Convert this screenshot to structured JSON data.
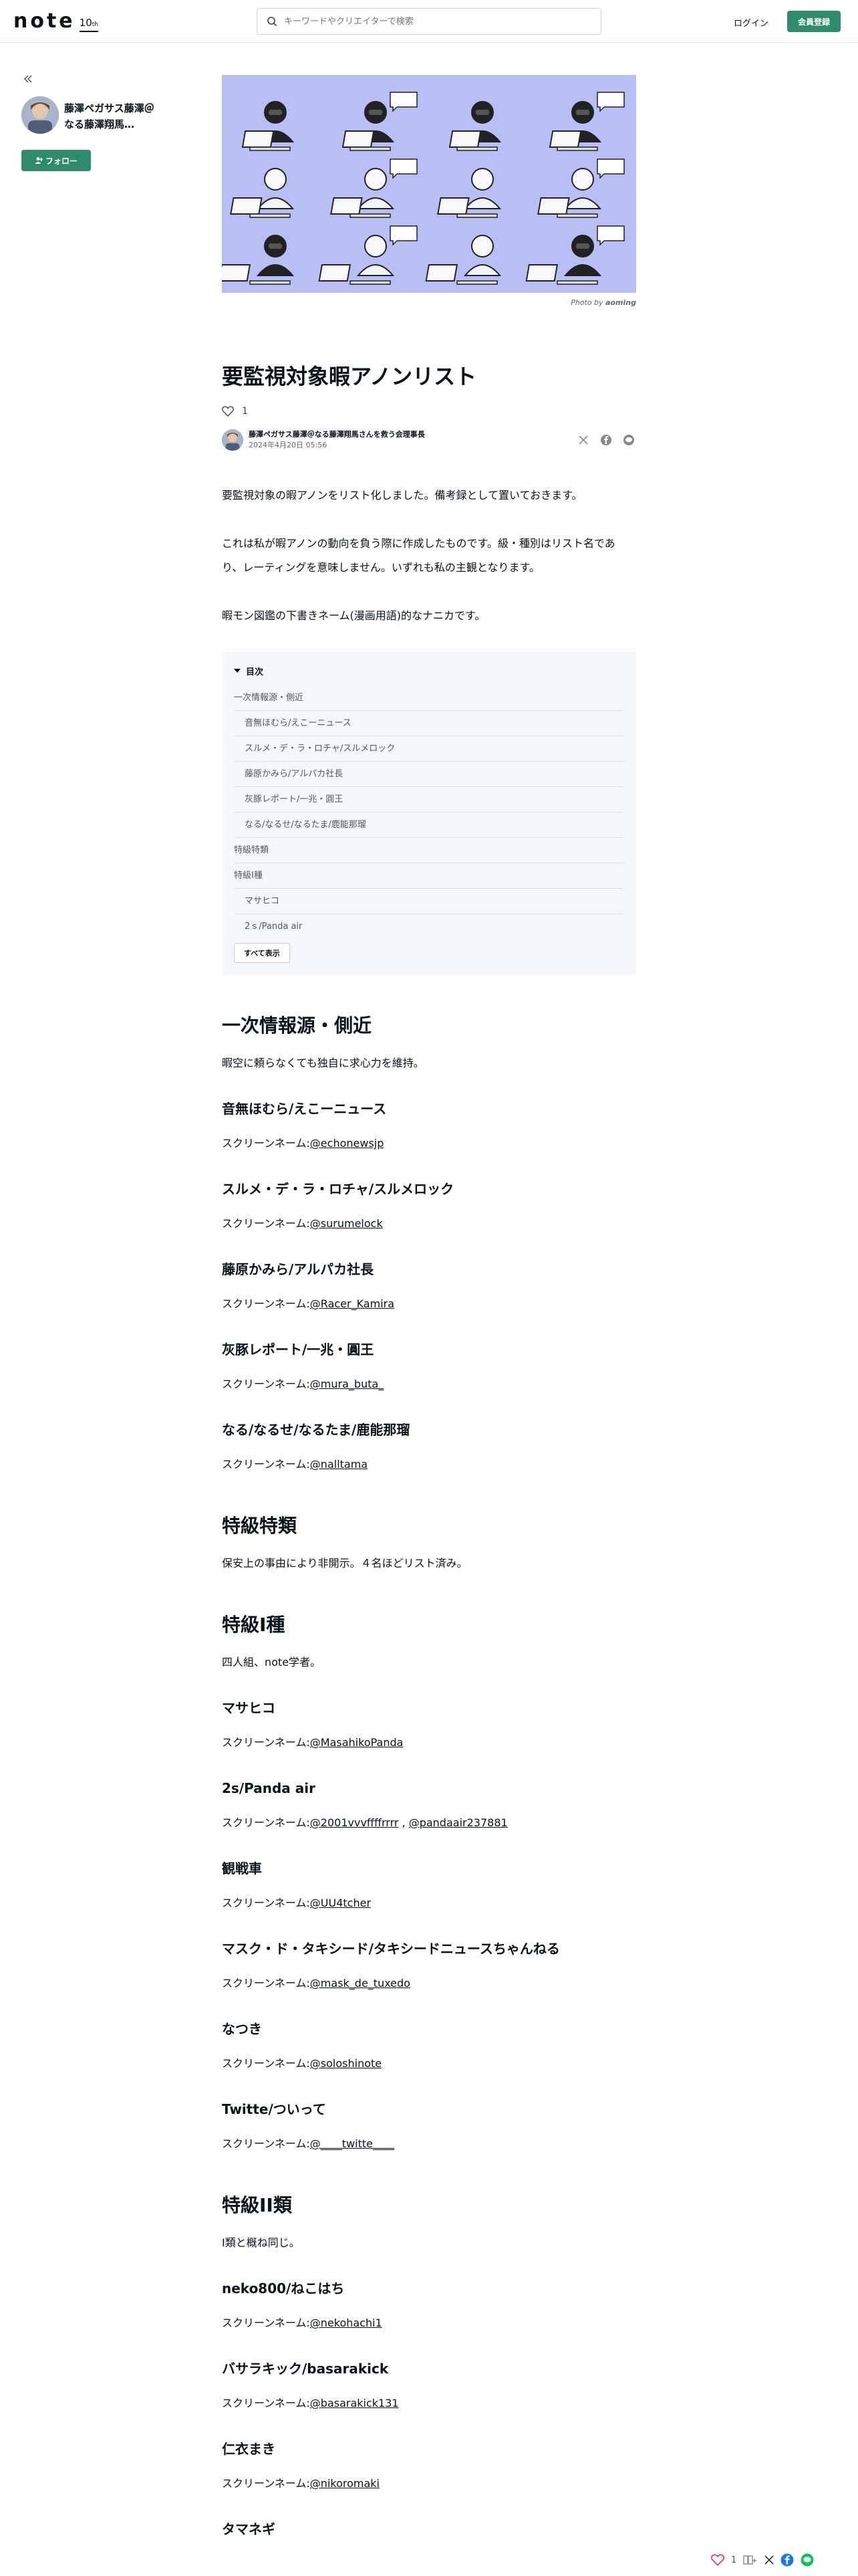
{
  "header": {
    "logo_text": "note",
    "logo_badge": "10",
    "logo_badge_suffix": "th",
    "search_placeholder": "キーワードやクリエイターで検索",
    "login_label": "ログイン",
    "signup_label": "会員登録"
  },
  "sidebar": {
    "author_name": "藤澤ペガサス藤澤＠なる藤澤翔馬…",
    "follow_label": "フォロー"
  },
  "article": {
    "photo_credit_prefix": "Photo by",
    "photo_credit_name": "aoming",
    "title": "要監視対象暇アノンリスト",
    "like_count": "1",
    "byline_name": "藤澤ペガサス藤澤＠なる藤澤翔馬さんを救う会理事長",
    "byline_date": "2024年4月20日 05:56",
    "intro": [
      "要監視対象の暇アノンをリスト化しました。備考録として置いておきます。",
      "これは私が暇アノンの動向を負う際に作成したものです。級・種別はリスト名であり、レーティングを意味しません。いずれも私の主観となります。",
      "暇モン図鑑の下書きネーム(漫画用語)的なナニカです。"
    ]
  },
  "toc": {
    "heading": "目次",
    "items": [
      {
        "label": "一次情報源・側近",
        "level": 1
      },
      {
        "label": "音無ほむら/えこーニュース",
        "level": 2
      },
      {
        "label": "スルメ・デ・ラ・ロチャ/スルメロック",
        "level": 2
      },
      {
        "label": "藤原かみら/アルパカ社長",
        "level": 2
      },
      {
        "label": "灰豚レポート/一兆・圓王",
        "level": 2
      },
      {
        "label": "なる/なるせ/なるたま/鹿能那瑠",
        "level": 2
      },
      {
        "label": "特級特類",
        "level": 1
      },
      {
        "label": "特級I種",
        "level": 1
      },
      {
        "label": "マサヒコ",
        "level": 2
      },
      {
        "label": "2ｓ/Panda air",
        "level": 2
      }
    ],
    "show_all_label": "すべて表示"
  },
  "sections": {
    "s1": {
      "title": "一次情報源・側近",
      "desc": "暇空に頼らなくても独自に求心力を維持。"
    },
    "p1": {
      "name": "音無ほむら/えこーニュース",
      "prefix": "スクリーンネーム:",
      "handle": "@echonewsjp"
    },
    "p2": {
      "name": "スルメ・デ・ラ・ロチャ/スルメロック",
      "prefix": "スクリーンネーム:",
      "handle": "@surumelock"
    },
    "p3": {
      "name": "藤原かみら/アルパカ社長",
      "prefix": "スクリーンネーム:",
      "handle": "@Racer_Kamira"
    },
    "p4": {
      "name": "灰豚レポート/一兆・圓王",
      "prefix": "スクリーンネーム:",
      "handle": "@mura_buta_"
    },
    "p5": {
      "name": "なる/なるせ/なるたま/鹿能那瑠",
      "prefix": "スクリーンネーム:",
      "handle": "@nalltama"
    },
    "s2": {
      "title": "特級特類",
      "desc": "保安上の事由により非開示。４名ほどリスト済み。"
    },
    "s3": {
      "title": "特級I種",
      "desc": "四人組、note学者。"
    },
    "p6": {
      "name": "マサヒコ",
      "prefix": "スクリーンネーム:",
      "handle": "@MasahikoPanda"
    },
    "p7": {
      "name": "2s/Panda air",
      "prefix": "スクリーンネーム:",
      "handle": "@2001vvvffffrrrr",
      "sep": " , ",
      "handle2": "@pandaair237881"
    },
    "p8": {
      "name": "観戦車",
      "prefix": "スクリーンネーム:",
      "handle": "@UU4tcher"
    },
    "p9": {
      "name": "マスク・ド・タキシード/タキシードニュースちゃんねる",
      "prefix": "スクリーンネーム:",
      "handle": "@mask_de_tuxedo"
    },
    "p10": {
      "name": "なつき",
      "prefix": "スクリーンネーム:",
      "handle": "@soloshinote"
    },
    "p11": {
      "name": "Twitte/ついって",
      "prefix": "スクリーンネーム:",
      "handle": "@____twitte____"
    },
    "s4": {
      "title": "特級II類",
      "desc": "I類と概ね同じ。"
    },
    "p12": {
      "name": "neko800/ねこはち",
      "prefix": "スクリーンネーム:",
      "handle": "@nekohachi1"
    },
    "p13": {
      "name": "バサラキック/basarakick",
      "prefix": "スクリーンネーム:",
      "handle": "@basarakick131"
    },
    "p14": {
      "name": "仁衣まき",
      "prefix": "スクリーンネーム:",
      "handle": "@nikoromaki"
    },
    "p15": {
      "name": "タマネギ"
    }
  },
  "float_bar": {
    "like_count": "1"
  },
  "colors": {
    "accent": "#2e8b6e",
    "hero_bg": "#b7bff5",
    "toc_bg": "#f5f8fa"
  }
}
